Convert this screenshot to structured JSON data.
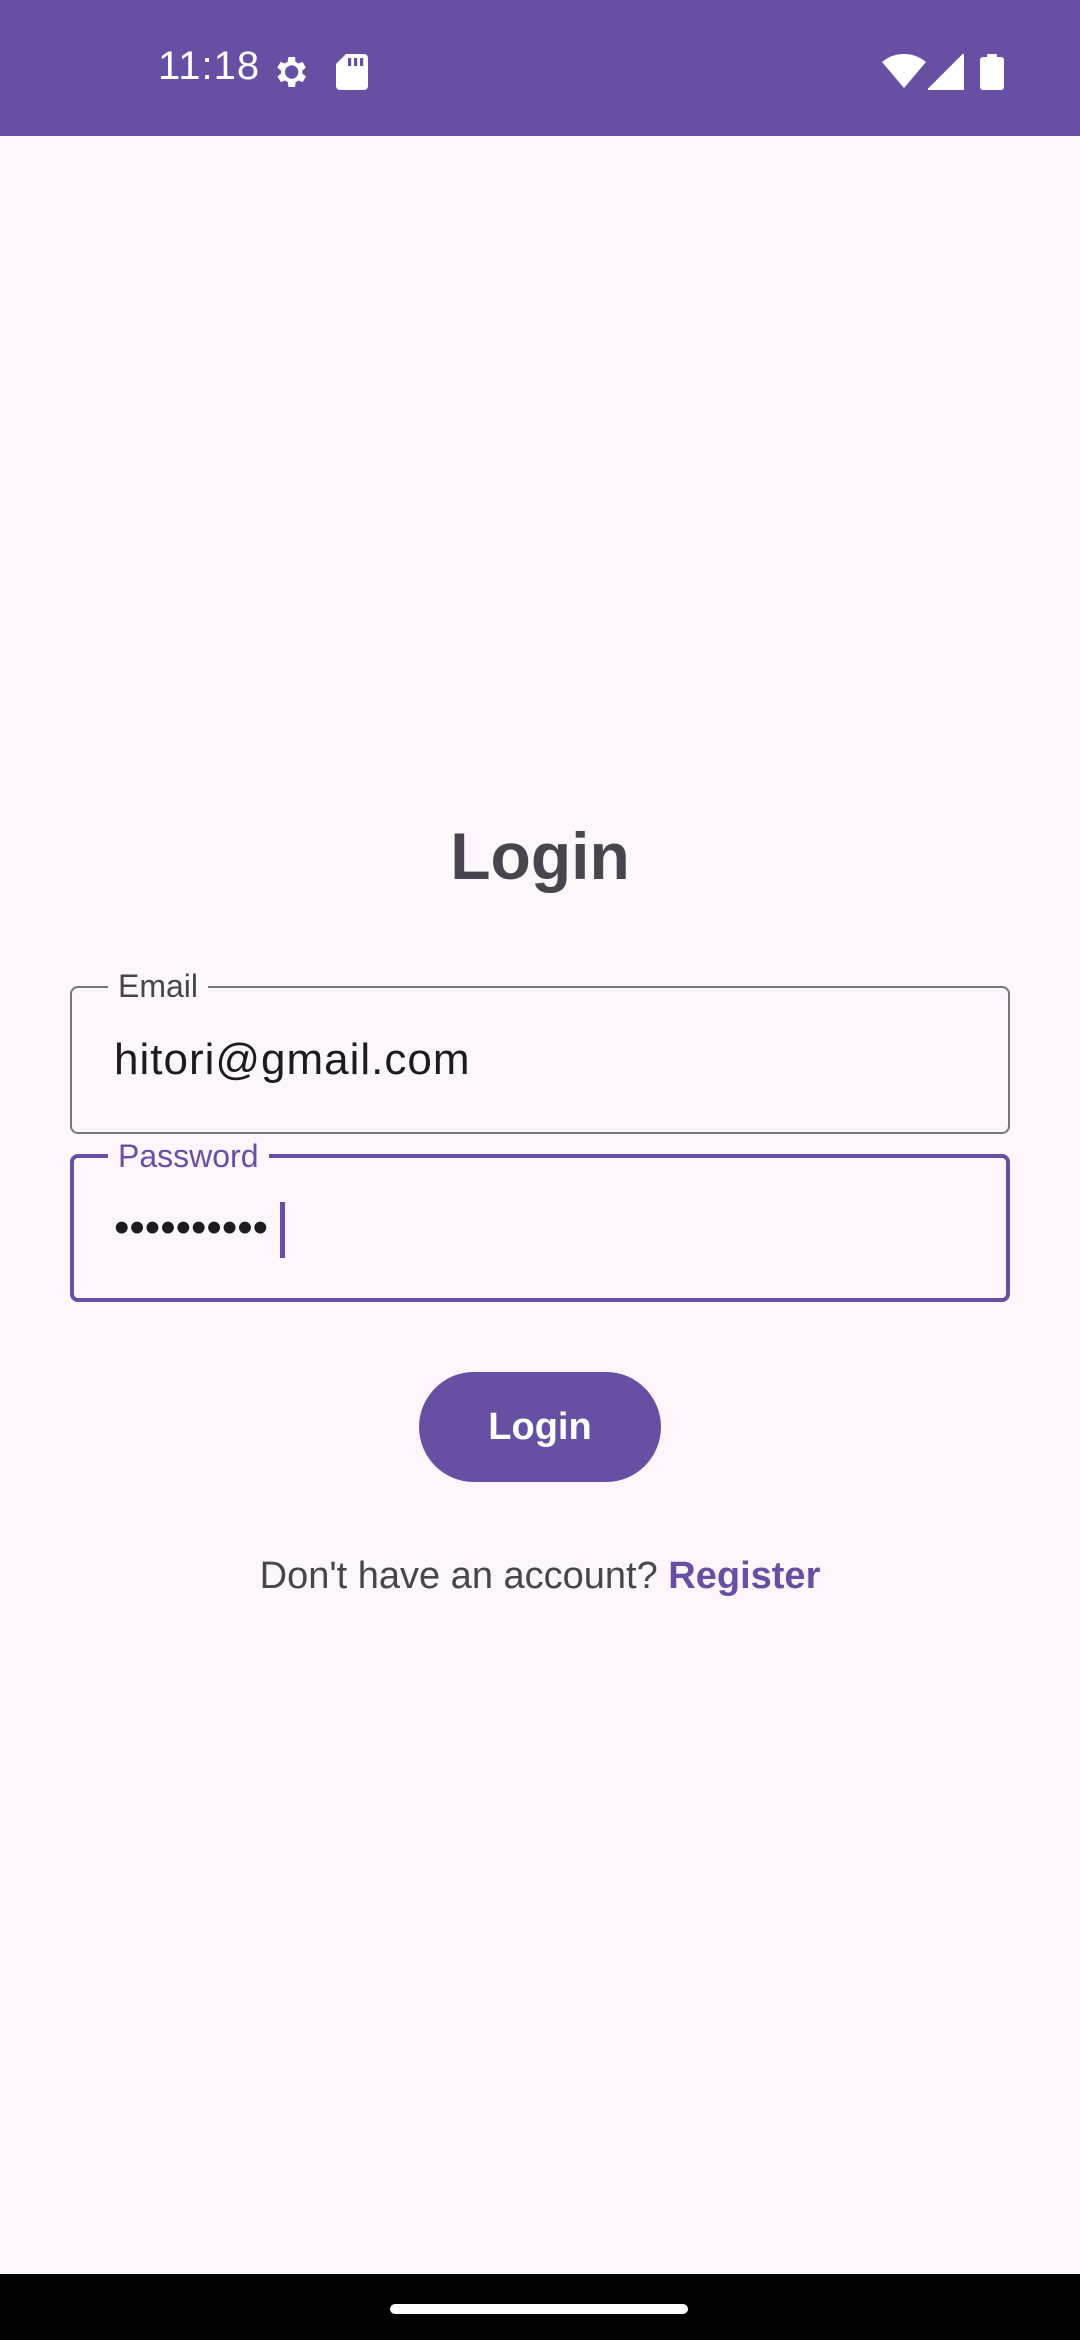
{
  "status_bar": {
    "time": "11:18",
    "icons": [
      "gear-icon",
      "sd-card-icon",
      "wifi-icon",
      "signal-icon",
      "battery-icon"
    ],
    "background": "#6650A4"
  },
  "main": {
    "title": "Login",
    "email_field": {
      "label": "Email",
      "value": "hitori@gmail.com"
    },
    "password_field": {
      "label": "Password",
      "value": "••••••••••",
      "focused": true
    },
    "login_button": {
      "label": "Login"
    },
    "register": {
      "prompt": "Don't have an account? ",
      "link": "Register"
    }
  },
  "colors": {
    "primary": "#6650A4",
    "background": "#FDF7FC",
    "text": "#49454F"
  }
}
